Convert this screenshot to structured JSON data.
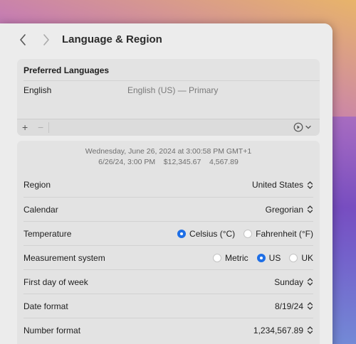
{
  "window": {
    "title": "Language & Region"
  },
  "preferred_languages": {
    "heading": "Preferred Languages",
    "items": [
      {
        "name": "English",
        "detail": "English (US) — Primary"
      }
    ],
    "toolbar": {
      "add": "+",
      "remove": "−"
    }
  },
  "preview": {
    "line1": "Wednesday, June 26, 2024 at 3:00:58 PM GMT+1",
    "line2": "6/26/24, 3:00 PM    $12,345.67    4,567.89"
  },
  "settings": {
    "region": {
      "label": "Region",
      "value": "United States"
    },
    "calendar": {
      "label": "Calendar",
      "value": "Gregorian"
    },
    "temperature": {
      "label": "Temperature",
      "options": [
        "Celsius (°C)",
        "Fahrenheit (°F)"
      ],
      "selected": "Celsius (°C)"
    },
    "measurement": {
      "label": "Measurement system",
      "options": [
        "Metric",
        "US",
        "UK"
      ],
      "selected": "US"
    },
    "first_day": {
      "label": "First day of week",
      "value": "Sunday"
    },
    "date_format": {
      "label": "Date format",
      "value": "8/19/24"
    },
    "number_format": {
      "label": "Number format",
      "value": "1,234,567.89"
    }
  },
  "colors": {
    "accent": "#1e6fe6"
  }
}
